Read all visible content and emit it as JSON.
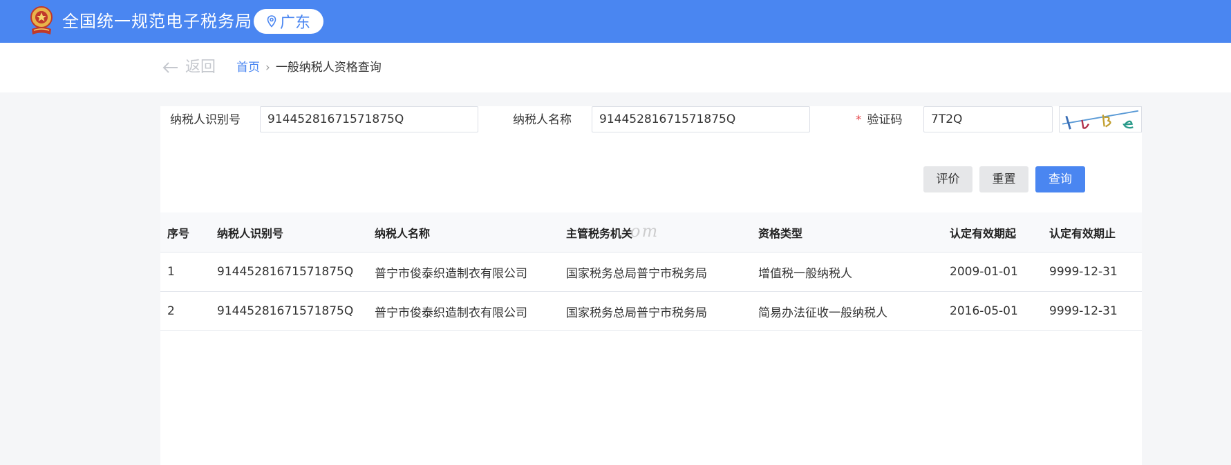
{
  "header": {
    "site_title": "全国统一规范电子税务局",
    "region": "广东",
    "logo_icon": "tax-emblem-icon",
    "location_icon": "location-pin-icon",
    "brand_color": "#4a86f1"
  },
  "nav": {
    "back_label": "返回",
    "breadcrumb": {
      "home": "首页",
      "separator": "›",
      "current": "一般纳税人资格查询"
    }
  },
  "form": {
    "taxpayer_id_label": "纳税人识别号",
    "taxpayer_id_value": "91445281671571875Q",
    "taxpayer_name_label": "纳税人名称",
    "taxpayer_name_value": "91445281671571875Q",
    "captcha_required_mark": "*",
    "captcha_label": "验证码",
    "captcha_value": "7T2Q"
  },
  "actions": {
    "evaluate": "评价",
    "reset": "重置",
    "query": "查询"
  },
  "table": {
    "columns": [
      "序号",
      "纳税人识别号",
      "纳税人名称",
      "主管税务机关",
      "资格类型",
      "认定有效期起",
      "认定有效期止"
    ],
    "watermark": "om",
    "rows": [
      [
        "1",
        "91445281671571875Q",
        "普宁市俊泰织造制衣有限公司",
        "国家税务总局普宁市税务局",
        "增值税一般纳税人",
        "2009-01-01",
        "9999-12-31"
      ],
      [
        "2",
        "91445281671571875Q",
        "普宁市俊泰织造制衣有限公司",
        "国家税务总局普宁市税务局",
        "简易办法征收一般纳税人",
        "2016-05-01",
        "9999-12-31"
      ]
    ]
  }
}
